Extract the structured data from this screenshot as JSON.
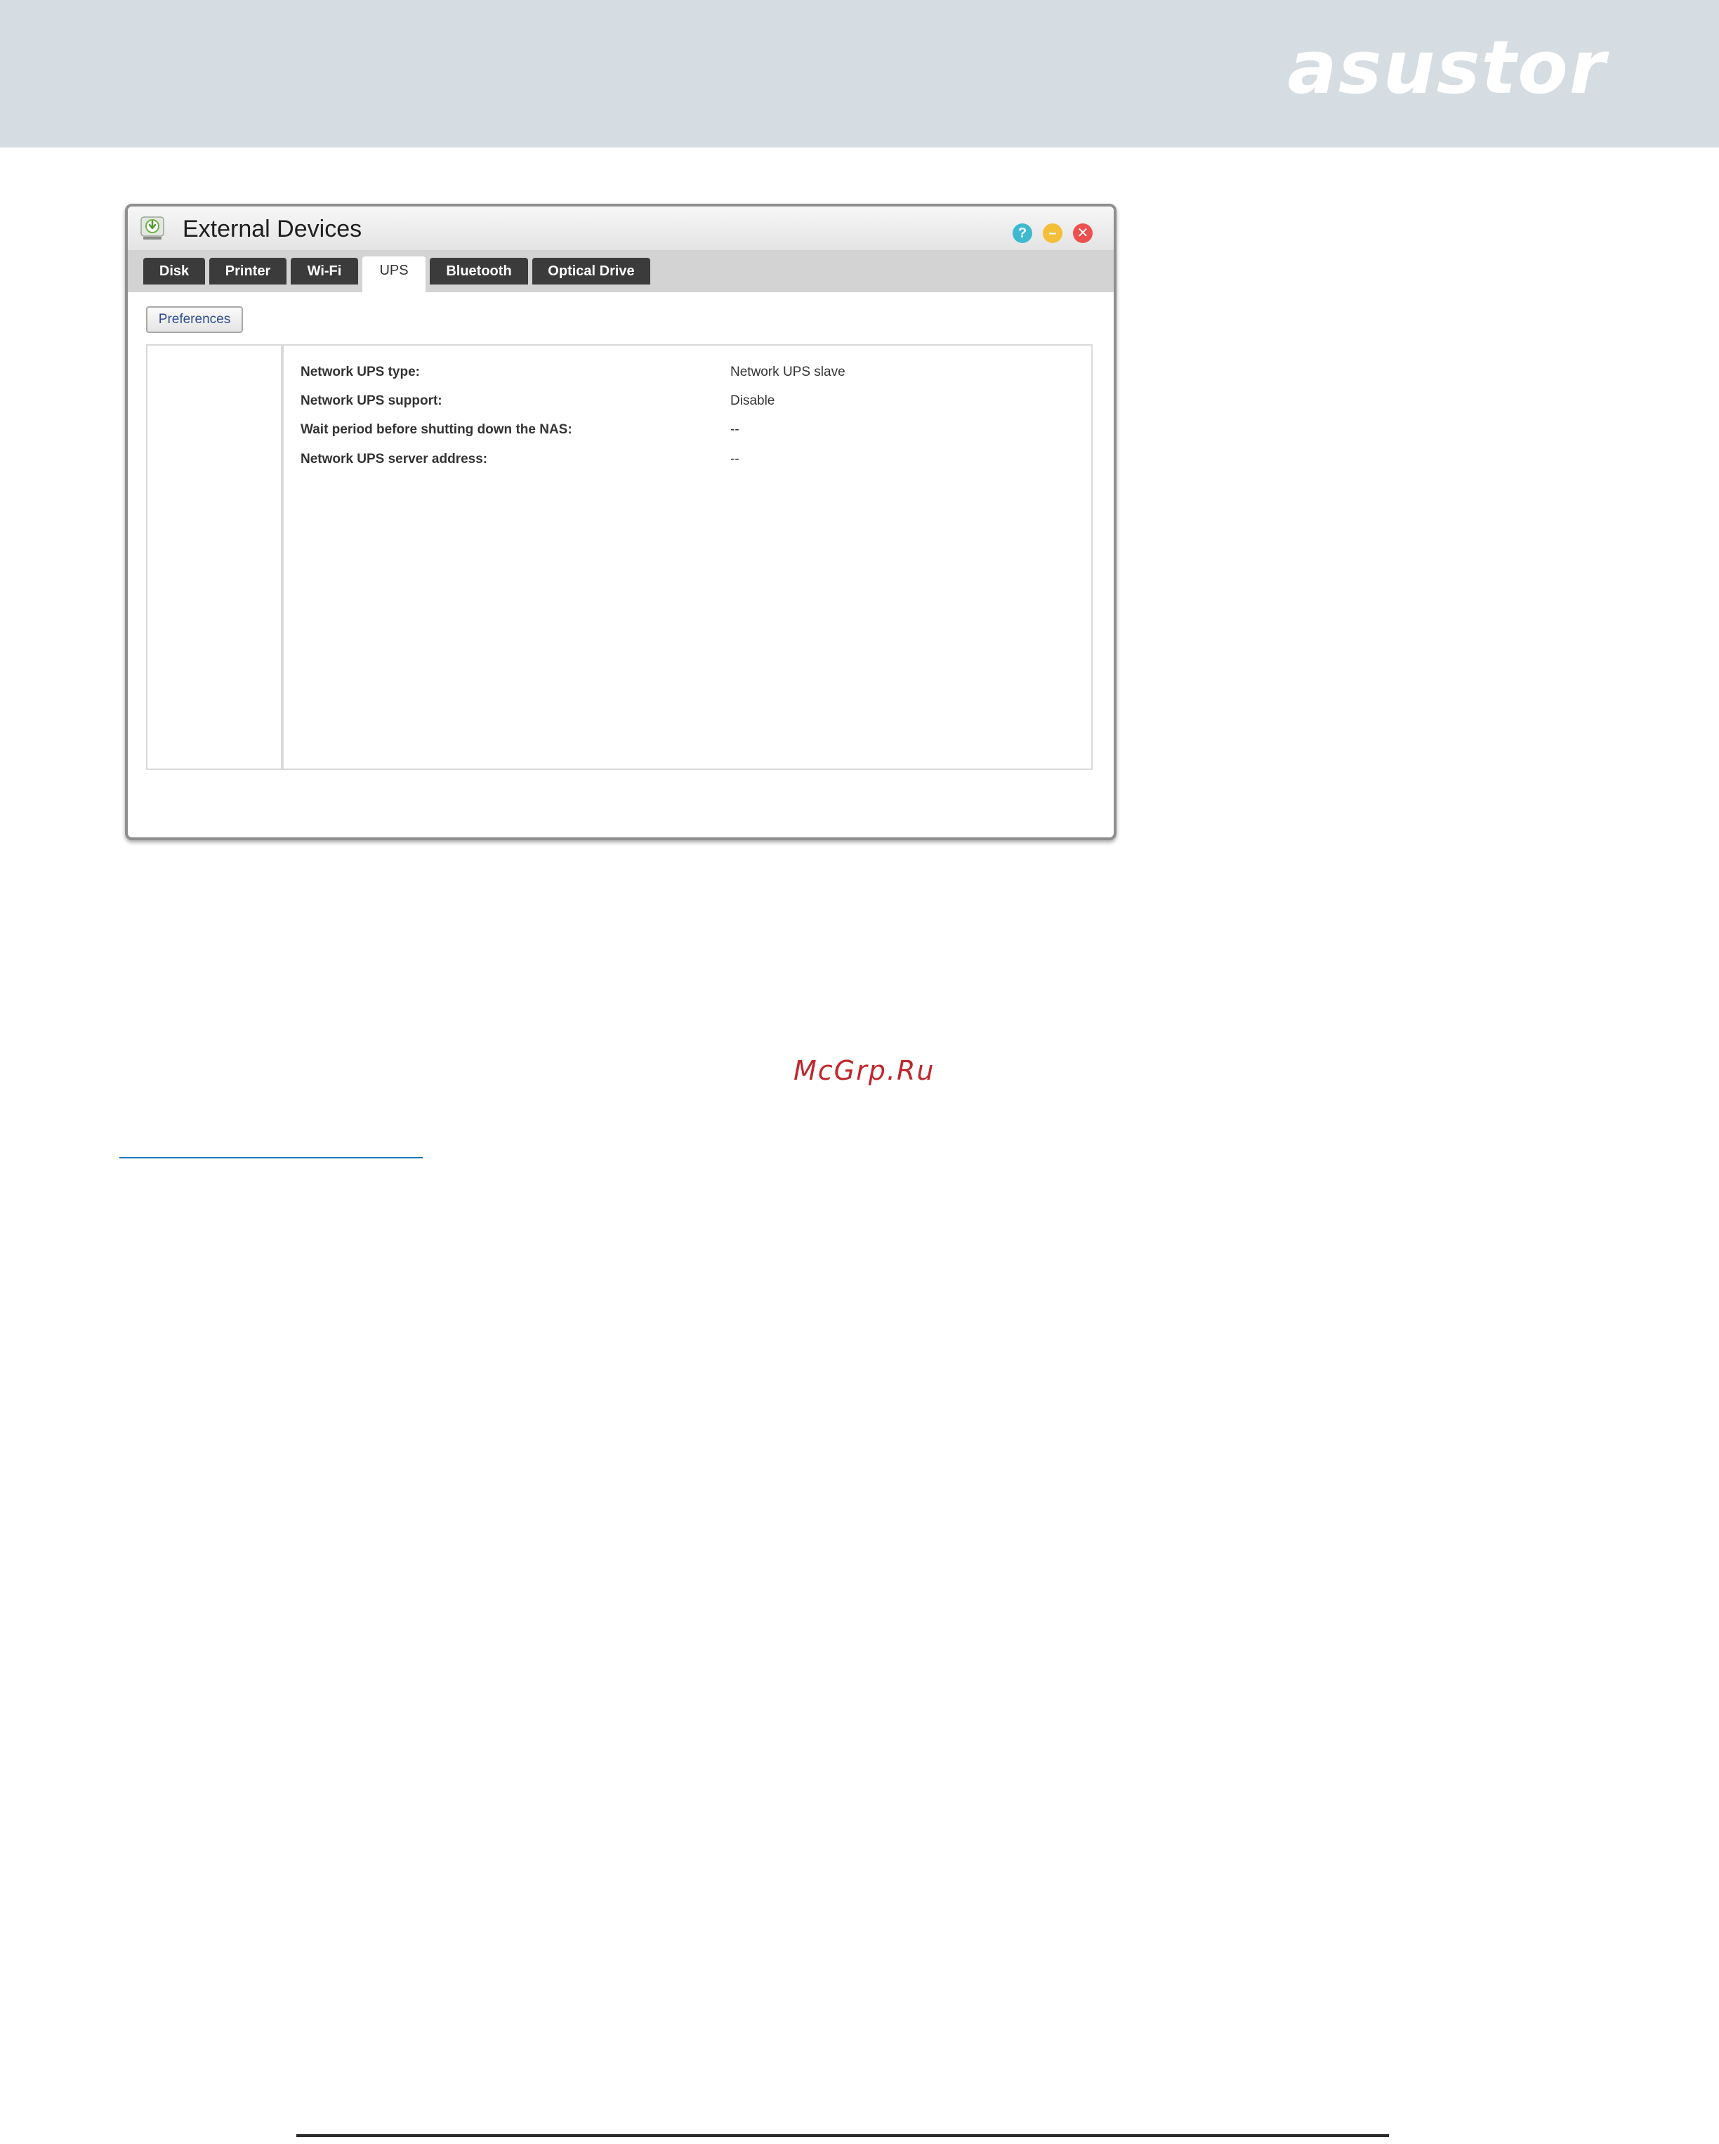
{
  "header": {
    "logo_text": "asustor",
    "background_color": "#d6dde2"
  },
  "window": {
    "title": "External Devices",
    "app_icon": "external-devices-icon",
    "controls": {
      "help": "?",
      "minimize": "–",
      "close": "✕"
    },
    "tabs": [
      {
        "label": "Disk",
        "active": false
      },
      {
        "label": "Printer",
        "active": false
      },
      {
        "label": "Wi-Fi",
        "active": false
      },
      {
        "label": "UPS",
        "active": true
      },
      {
        "label": "Bluetooth",
        "active": false
      },
      {
        "label": "Optical Drive",
        "active": false
      }
    ],
    "preferences_button": "Preferences",
    "info_rows": [
      {
        "label": "Network UPS type:",
        "value": "Network UPS slave"
      },
      {
        "label": "Network UPS support:",
        "value": "Disable"
      },
      {
        "label": "Wait period before shutting down the NAS:",
        "value": "--"
      },
      {
        "label": "Network UPS server address:",
        "value": "--"
      }
    ]
  },
  "watermark": "McGrp.Ru",
  "colors": {
    "tab_dark": "#3b3b3b",
    "help_button": "#3fb9cf",
    "minimize_button": "#f3be39",
    "close_button": "#ee4f4f",
    "watermark": "#c0272d",
    "footnote_rule": "#1f78b4"
  }
}
